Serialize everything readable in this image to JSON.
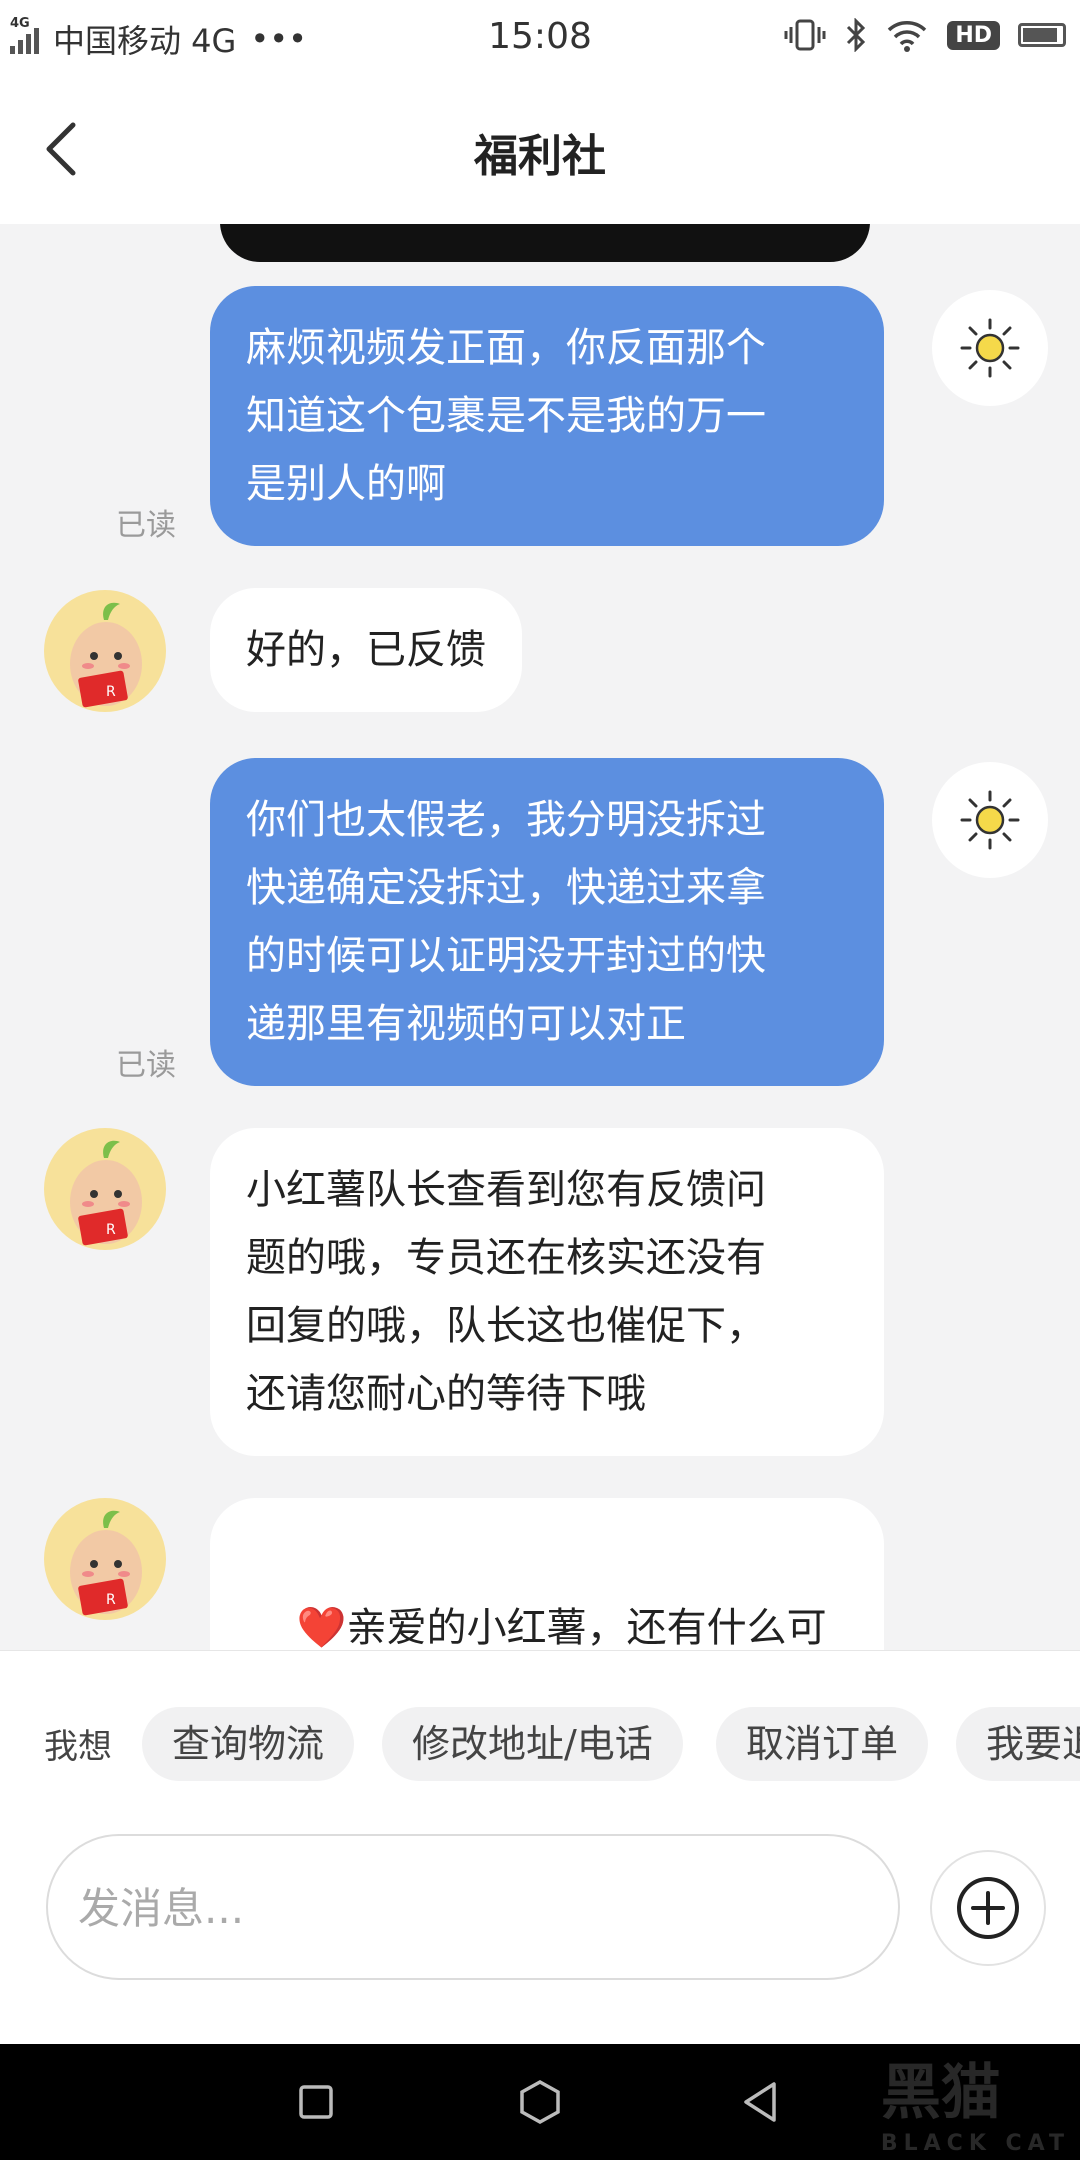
{
  "status_bar": {
    "network_tag": "4G",
    "carrier": "中国移动 4G",
    "dots": "•••",
    "time": "15:08",
    "hd_badge": "HD"
  },
  "header": {
    "title": "福利社"
  },
  "messages": [
    {
      "side": "me",
      "text": "麻烦视频发正面，你反面那个\n知道这个包裹是不是我的万一\n是别人的啊",
      "status": "已读"
    },
    {
      "side": "them",
      "text": "好的，已反馈"
    },
    {
      "side": "me",
      "text": "你们也太假老，我分明没拆过\n快递确定没拆过，快递过来拿\n的时候可以证明没开封过的快\n递那里有视频的可以对正",
      "status": "已读"
    },
    {
      "side": "them",
      "text": "小红薯队长查看到您有反馈问\n题的哦，专员还在核实还没有\n回复的哦，队长这也催促下，\n还请您耐心的等待下哦"
    },
    {
      "side": "them",
      "heart": "❤️",
      "text": "亲爱的小红薯，还有什么可\n以帮您的吗?"
    }
  ],
  "quick_actions": {
    "label": "我想",
    "chips": [
      "查询物流",
      "修改地址/电话",
      "取消订单",
      "我要退"
    ]
  },
  "composer": {
    "placeholder": "发消息..."
  },
  "watermark": {
    "text": "黑猫",
    "sub": "BLACK CAT"
  },
  "colors": {
    "my_bubble": "#5c8fe0",
    "their_bubble": "#ffffff",
    "background": "#f3f3f4"
  }
}
